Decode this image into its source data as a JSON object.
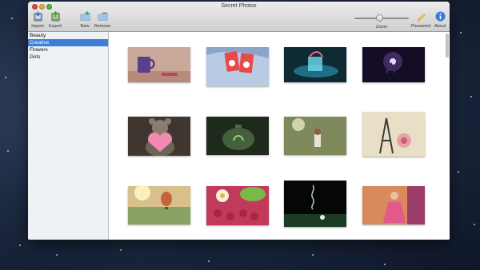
{
  "window": {
    "title": "Secret Photos"
  },
  "toolbar": {
    "import_label": "Import",
    "export_label": "Export",
    "new_label": "New",
    "remove_label": "Remove",
    "zoom_label": "Zoom",
    "zoom_level": 0.45,
    "password_label": "Password",
    "about_label": "About"
  },
  "sidebar": {
    "items": [
      {
        "label": "Beauty",
        "selected": false
      },
      {
        "label": "Creative",
        "selected": true
      },
      {
        "label": "Flowers",
        "selected": false
      },
      {
        "label": "Girls",
        "selected": false
      }
    ]
  },
  "thumbnails": [
    {
      "subject": "purple mug on table",
      "colors": [
        "#c9a99a",
        "#e8d6cc"
      ]
    },
    {
      "subject": "two cartoon cards on blue fabric",
      "colors": [
        "#8aa5c9",
        "#c4d2e6"
      ]
    },
    {
      "subject": "glowing blue cube",
      "colors": [
        "#0e2a33",
        "#1a5c6b"
      ]
    },
    {
      "subject": "glowing hands in dark",
      "colors": [
        "#150d25",
        "#3a2a55"
      ]
    },
    {
      "subject": "teddy bear holding pink heart",
      "colors": [
        "#3f3630",
        "#8a7a68"
      ]
    },
    {
      "subject": "teapot with plant inside",
      "colors": [
        "#1e2a1c",
        "#4a6640"
      ]
    },
    {
      "subject": "child in sunlit field",
      "colors": [
        "#7e8a5c",
        "#c9b88a"
      ]
    },
    {
      "subject": "eiffel tower figurine with rose",
      "colors": [
        "#e9dfc6",
        "#c9b59a"
      ]
    },
    {
      "subject": "hot air balloon at sunset",
      "colors": [
        "#d8c08a",
        "#8fa866"
      ]
    },
    {
      "subject": "raspberries and daisy",
      "colors": [
        "#c23a5a",
        "#7ab84a"
      ]
    },
    {
      "subject": "smoke over billiard table",
      "colors": [
        "#050705",
        "#1a3a22"
      ]
    },
    {
      "subject": "girl in pink dress",
      "colors": [
        "#d88a5a",
        "#a23a6a"
      ]
    }
  ],
  "accent_color": "#3d7ed8"
}
